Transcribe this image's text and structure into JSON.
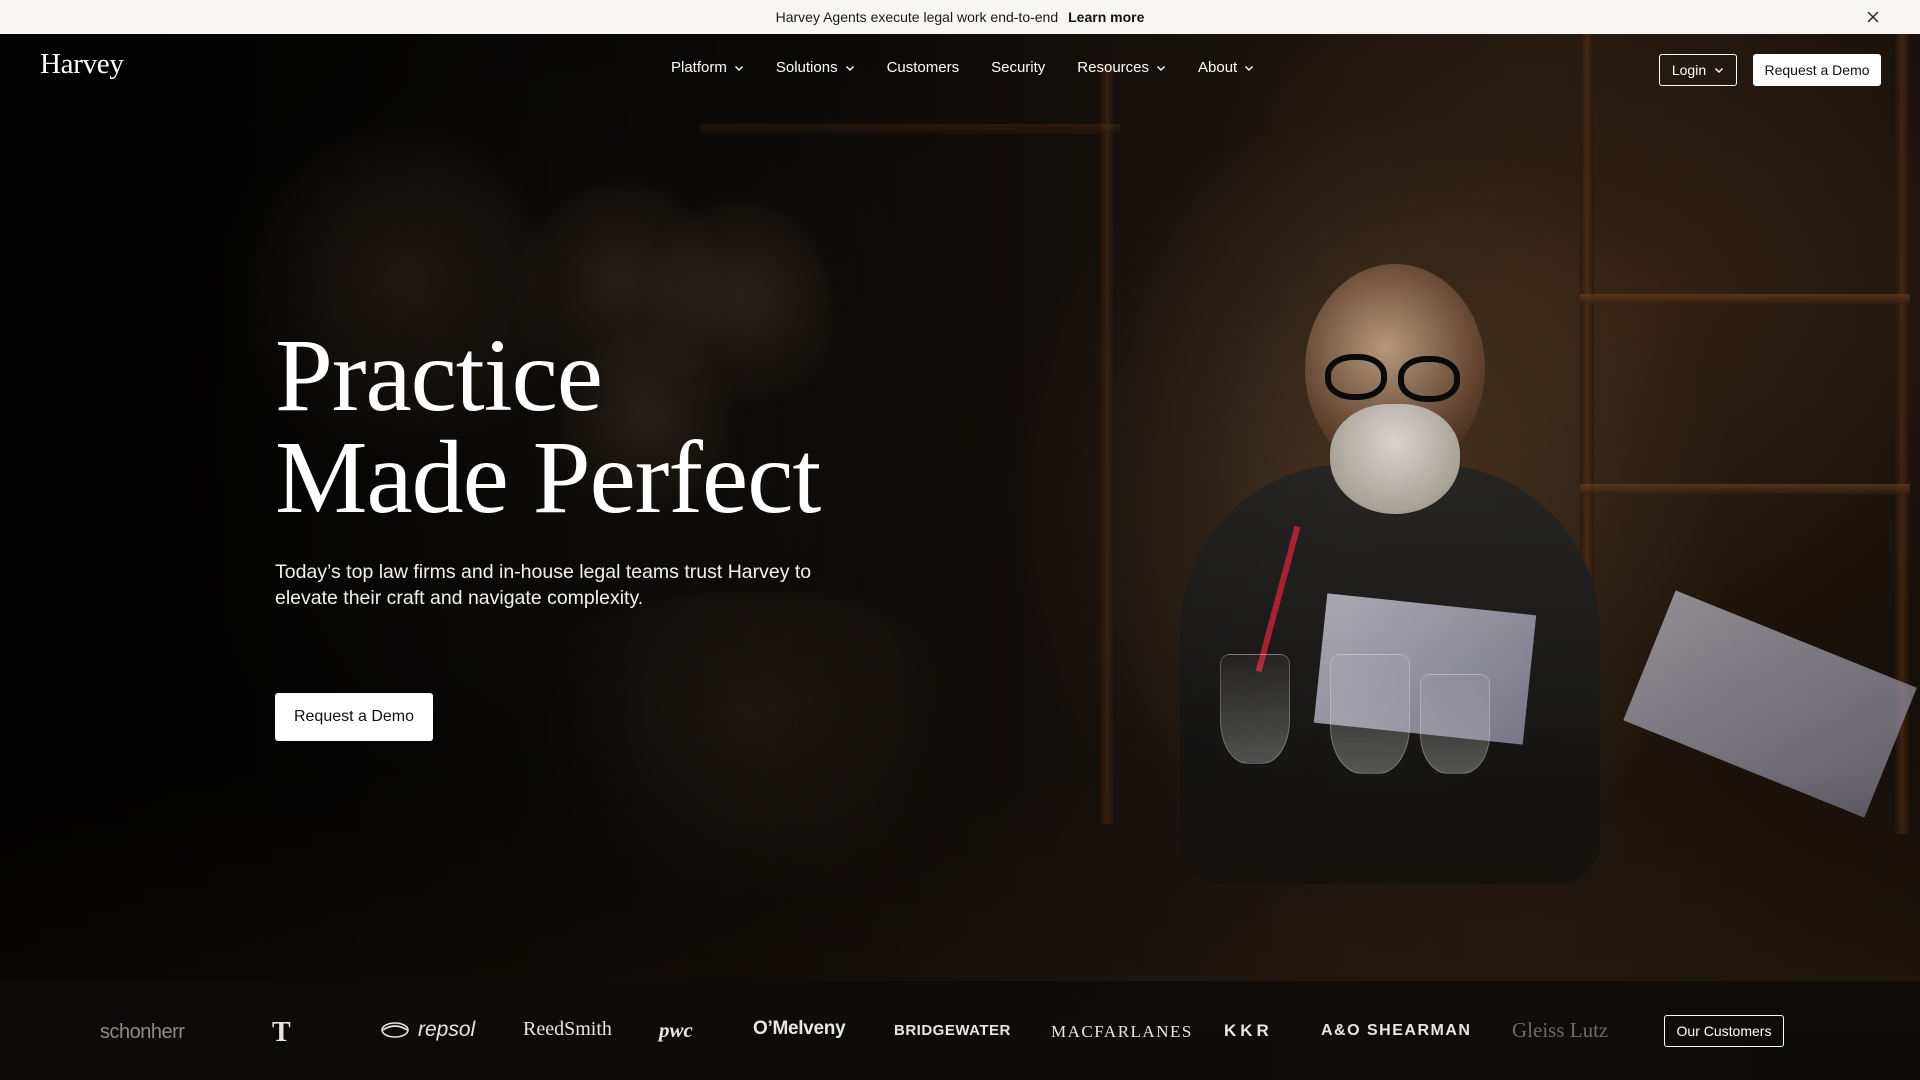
{
  "announcement": {
    "message": "Harvey Agents execute legal work end-to-end",
    "link_label": "Learn more",
    "close_icon": "close-icon"
  },
  "nav": {
    "logo": "Harvey",
    "items": [
      {
        "label": "Platform",
        "has_dropdown": true
      },
      {
        "label": "Solutions",
        "has_dropdown": true
      },
      {
        "label": "Customers",
        "has_dropdown": false
      },
      {
        "label": "Security",
        "has_dropdown": false
      },
      {
        "label": "Resources",
        "has_dropdown": true
      },
      {
        "label": "About",
        "has_dropdown": true
      }
    ],
    "login_label": "Login",
    "demo_label": "Request a Demo"
  },
  "hero": {
    "headline_line1": "Practice",
    "headline_line2": "Made Perfect",
    "subhead": "Today’s top law firms and in-house legal teams trust Harvey to elevate their craft and navigate complexity.",
    "cta_label": "Request a Demo"
  },
  "logos": {
    "items": [
      "schonherr",
      "T",
      "repsol",
      "ReedSmith",
      "pwc",
      "O’Melveny",
      "BRIDGEWATER",
      "MACFARLANES",
      "KKR",
      "A&O SHEARMAN",
      "Gleiss Lutz"
    ],
    "customers_button": "Our Customers"
  },
  "colors": {
    "announcement_bg": "#f7f6f3",
    "hero_bg": "#0b0a08",
    "primary_button_bg": "#ffffff",
    "text": "#ffffff"
  }
}
